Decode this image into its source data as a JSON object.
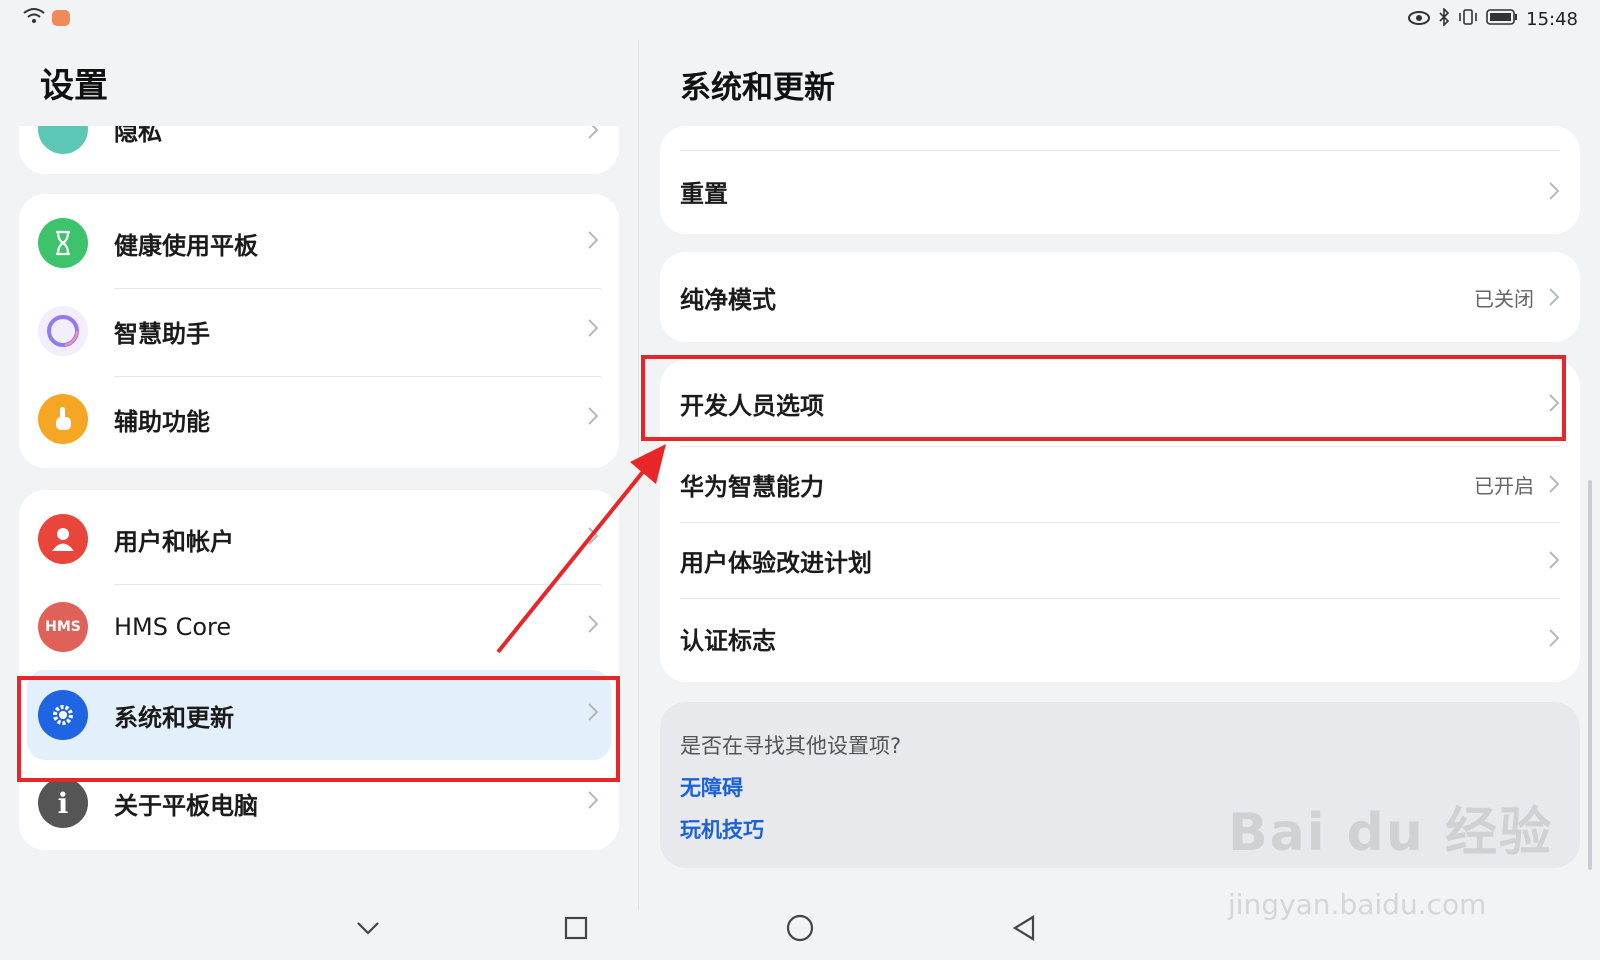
{
  "status": {
    "time": "15:48"
  },
  "left_pane": {
    "title": "设置",
    "partial_item": "隐私",
    "group1": [
      {
        "label": "健康使用平板",
        "icon": "hourglass-icon",
        "color": "#3cc36b"
      },
      {
        "label": "智慧助手",
        "icon": "assistant-ring-icon",
        "color": "#8f7cf0"
      },
      {
        "label": "辅助功能",
        "icon": "hand-pointer-icon",
        "color": "#f5a623"
      }
    ],
    "group2": [
      {
        "label": "用户和帐户",
        "icon": "user-icon",
        "color": "#e8463a"
      },
      {
        "label": "HMS Core",
        "icon": "hms-icon",
        "icon_text": "HMS",
        "color": "#e0605a"
      },
      {
        "label": "系统和更新",
        "icon": "gear-icon",
        "color": "#1f64e0",
        "selected": true
      },
      {
        "label": "关于平板电脑",
        "icon": "info-icon",
        "icon_text": "i",
        "color": "#555555"
      }
    ]
  },
  "right_pane": {
    "title": "系统和更新",
    "reset_label": "重置",
    "pure_mode": {
      "label": "纯净模式",
      "value": "已关闭"
    },
    "group3": [
      {
        "label": "开发人员选项",
        "value": ""
      },
      {
        "label": "华为智慧能力",
        "value": "已开启"
      },
      {
        "label": "用户体验改进计划",
        "value": ""
      },
      {
        "label": "认证标志",
        "value": ""
      }
    ],
    "search_hint": {
      "question": "是否在寻找其他设置项?",
      "links": [
        "无障碍",
        "玩机技巧"
      ]
    }
  },
  "watermark": {
    "brand": "Bai du 经验",
    "url": "jingyan.baidu.com"
  },
  "colors": {
    "highlight": "#e8262a",
    "link": "#1b62d6",
    "selected_bg": "#e3effb"
  }
}
